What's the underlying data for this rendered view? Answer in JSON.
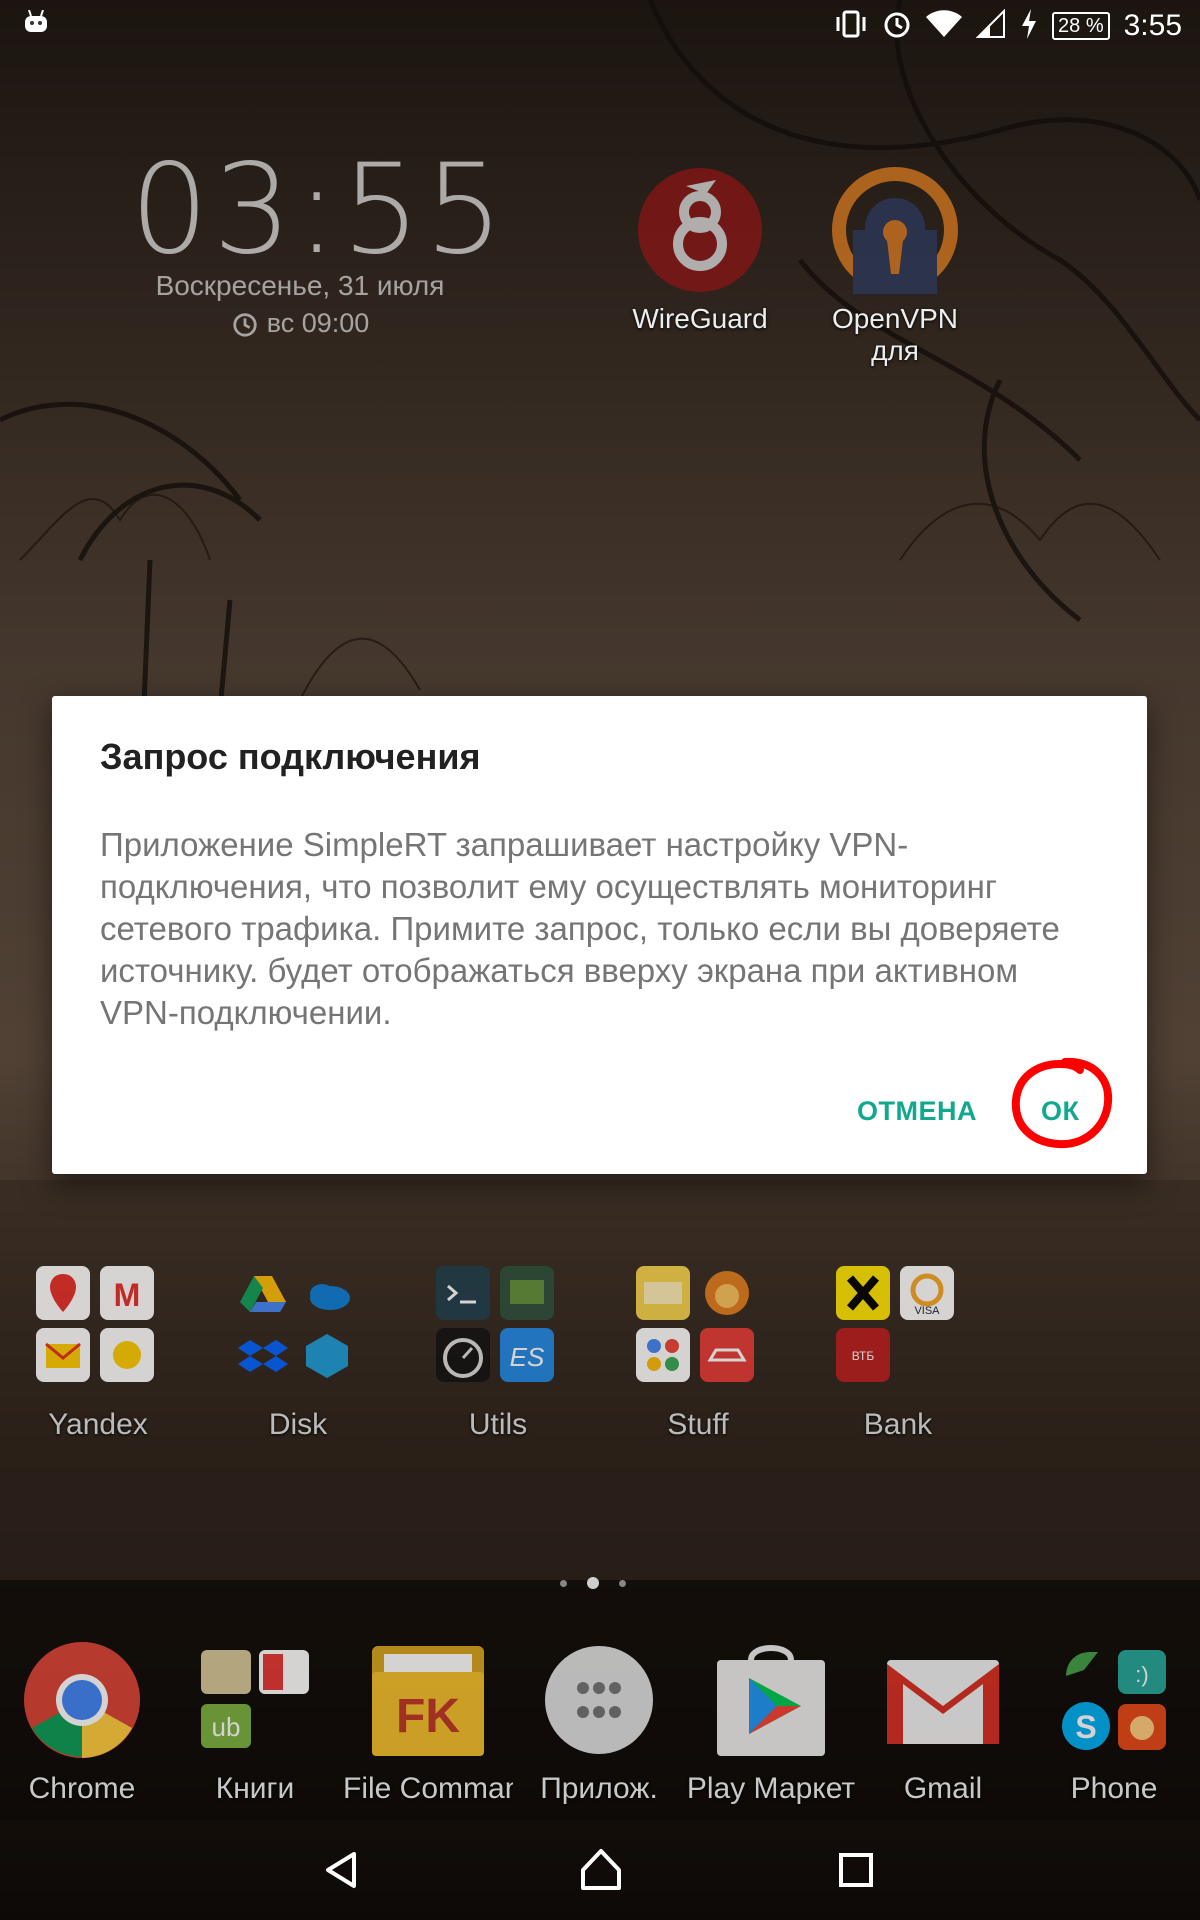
{
  "status_bar": {
    "time": "3:55",
    "battery_percent": "28 %",
    "icons": [
      "android-icon",
      "vibrate-icon",
      "alarm-icon",
      "wifi-icon",
      "signal-icon",
      "charging-icon",
      "battery-icon"
    ]
  },
  "clock_widget": {
    "time": "03:55",
    "date": "Воскресенье, 31 июля",
    "alarm": "вс 09:00"
  },
  "top_apps": [
    {
      "label": "WireGuard",
      "icon": "wireguard-icon"
    },
    {
      "label": "OpenVPN для",
      "icon": "openvpn-icon"
    }
  ],
  "dialog": {
    "title": "Запрос подключения",
    "message": "Приложение SimpleRT запрашивает настройку VPN-подключения, что позволит ему осуществлять мониторинг сетевого трафика. Примите запрос, только если вы доверяете источнику. будет отображаться вверху экрана при активном VPN-подключении.",
    "cancel_label": "ОТМЕНА",
    "ok_label": "ОК",
    "accent_color": "#12a88f",
    "highlight_color": "#ff0000"
  },
  "folders": [
    {
      "label": "Yandex"
    },
    {
      "label": "Disk"
    },
    {
      "label": "Utils"
    },
    {
      "label": "Stuff"
    },
    {
      "label": "Bank"
    }
  ],
  "dock": [
    {
      "label": "Chrome",
      "icon": "chrome-icon"
    },
    {
      "label": "Книги",
      "icon": "books-folder-icon"
    },
    {
      "label": "File Comman",
      "icon": "file-commander-icon"
    },
    {
      "label": "Прилож.",
      "icon": "app-drawer-icon"
    },
    {
      "label": "Play Маркет",
      "icon": "play-market-icon"
    },
    {
      "label": "Gmail",
      "icon": "gmail-icon"
    },
    {
      "label": "Phone",
      "icon": "phone-folder-icon"
    }
  ],
  "nav_bar": {
    "icons": [
      "back-icon",
      "home-icon",
      "recents-icon"
    ]
  }
}
